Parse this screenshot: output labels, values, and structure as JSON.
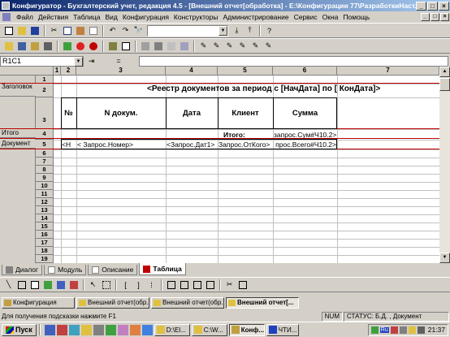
{
  "window": {
    "title": "Конфигуратор - Бухгалтерский учет, редакция 4.5 - [Внешний отчет[обработка] - E:\\Конфигурации 77\\РазработкиНаст...",
    "min": "_",
    "max": "□",
    "close": "×"
  },
  "menu": {
    "items": [
      "Файл",
      "Действия",
      "Таблица",
      "Вид",
      "Конфигурация",
      "Конструкторы",
      "Администрирование",
      "Сервис",
      "Окна",
      "Помощь"
    ]
  },
  "formula": {
    "cell_ref": "R1C1",
    "fx_label": "=",
    "value": ""
  },
  "grid": {
    "col_headers": [
      "1",
      "2",
      "3",
      "4",
      "5",
      "6",
      "7"
    ],
    "row_headers": [
      "1",
      "2",
      "3",
      "4",
      "5",
      "6",
      "7",
      "8",
      "9",
      "10",
      "11",
      "12",
      "13",
      "14",
      "15",
      "16",
      "17",
      "18",
      "19"
    ],
    "sections": {
      "header": "Заголовок",
      "total": "Итого",
      "document": "Документ"
    },
    "report_title": "<Реестр документов за период с [НачДата] по  [ КонДата]>",
    "table_headers": {
      "num": "№",
      "doc": "N докум.",
      "date": "Дата",
      "client": "Клиент",
      "sum": "Сумма"
    },
    "total_label": "Итого:",
    "total_value": "запрос.Сум#Ч10.2>",
    "doc_row": {
      "num": "<Н",
      "doc": "<   Запрос.Номер>",
      "date": "<Запрос.Дат1>",
      "client": "Запрос.ОтКого>",
      "sum": "прос.Всего#Ч10.2>"
    }
  },
  "tabs": [
    {
      "label": "Диалог",
      "active": false
    },
    {
      "label": "Модуль",
      "active": false
    },
    {
      "label": "Описание",
      "active": false
    },
    {
      "label": "Таблица",
      "active": true
    }
  ],
  "mdi_tasks": [
    {
      "label": "Конфигурация",
      "active": false
    },
    {
      "label": "Внешний отчет(обр...",
      "active": false
    },
    {
      "label": "Внешний отчет(обр...",
      "active": false
    },
    {
      "label": "Внешний отчет[...",
      "active": true
    }
  ],
  "status": {
    "hint": "Для получения подсказки нажмите F1",
    "num": "NUM",
    "status": "СТАТУС: Б.Д. , Документ"
  },
  "taskbar": {
    "start": "Пуск",
    "tasks": [
      {
        "label": "D:\\El...",
        "active": false
      },
      {
        "label": "C:\\W...",
        "active": false
      },
      {
        "label": "Конф...",
        "active": true
      },
      {
        "label": "ЧТИ...",
        "active": false
      }
    ],
    "lang": "Ru",
    "clock": "21:37"
  }
}
